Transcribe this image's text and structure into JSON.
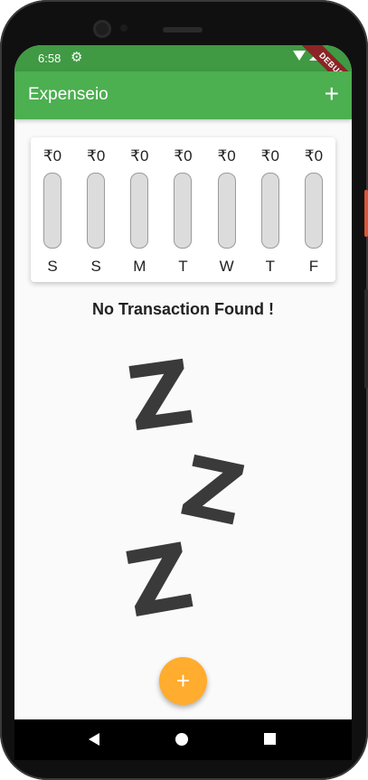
{
  "status_bar": {
    "time": "6:58",
    "icons": [
      "settings-gear-icon",
      "wifi-icon",
      "signal-icon",
      "battery-icon"
    ],
    "debug_banner": "DEBUG"
  },
  "app_bar": {
    "title": "Expenseio",
    "add_icon": "+",
    "color": "#4caf50"
  },
  "chart": {
    "bars": [
      {
        "amount": "₹0",
        "day": "S",
        "fill": 0
      },
      {
        "amount": "₹0",
        "day": "S",
        "fill": 0
      },
      {
        "amount": "₹0",
        "day": "M",
        "fill": 0
      },
      {
        "amount": "₹0",
        "day": "T",
        "fill": 0
      },
      {
        "amount": "₹0",
        "day": "W",
        "fill": 0
      },
      {
        "amount": "₹0",
        "day": "T",
        "fill": 0
      },
      {
        "amount": "₹0",
        "day": "F",
        "fill": 0
      }
    ]
  },
  "empty_state": {
    "message": "No Transaction Found !",
    "illustration": [
      "Z",
      "Z",
      "Z"
    ]
  },
  "fab": {
    "label": "+",
    "color": "#ffac2f"
  },
  "nav_bar": {
    "icons": [
      "back-icon",
      "home-icon",
      "recents-icon"
    ]
  }
}
